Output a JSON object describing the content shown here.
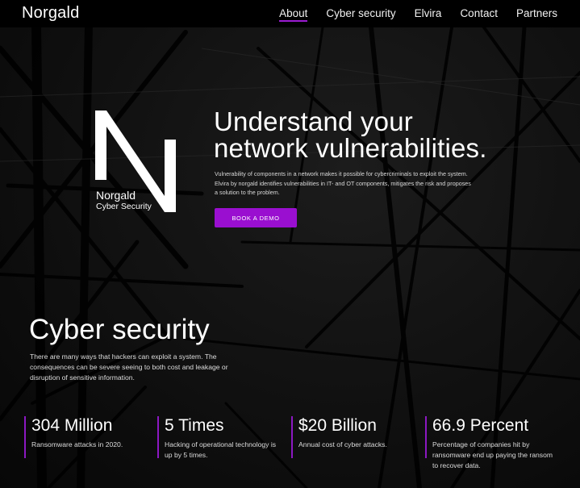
{
  "nav": {
    "brand": "Norgald",
    "items": [
      {
        "label": "About",
        "active": true
      },
      {
        "label": "Cyber security",
        "active": false
      },
      {
        "label": "Elvira",
        "active": false
      },
      {
        "label": "Contact",
        "active": false
      },
      {
        "label": "Partners",
        "active": false
      }
    ]
  },
  "logo": {
    "letter": "N",
    "name": "Norgald",
    "subtitle": "Cyber Security"
  },
  "hero": {
    "title_line1": "Understand your",
    "title_line2": "network vulnerabilities.",
    "text": "Vulnerability of components in a network makes it possible for cybercriminals to exploit the system. Elvira by norgald  identifies vulnerabilities in IT- and OT components, mitigates the risk and proposes a solution to the problem.",
    "button_label": "BOOK A DEMO"
  },
  "cyber": {
    "title": "Cyber security",
    "text": "There are many ways that hackers can exploit a system. The consequences can be severe seeing to both cost and leakage or disruption of sensitive information."
  },
  "stats": [
    {
      "value": "304 Million",
      "desc": "Ransomware attacks in 2020."
    },
    {
      "value": "5 Times",
      "desc": "Hacking of operational technology is up by 5 times."
    },
    {
      "value": "$20 Billion",
      "desc": "Annual cost of cyber attacks."
    },
    {
      "value": "66.9 Percent",
      "desc": "Percentage of companies hit by ransomware end up paying the ransom to recover data."
    }
  ],
  "colors": {
    "accent": "#9a0fd0",
    "background": "#0a0a0a",
    "nav_background": "#000000"
  }
}
